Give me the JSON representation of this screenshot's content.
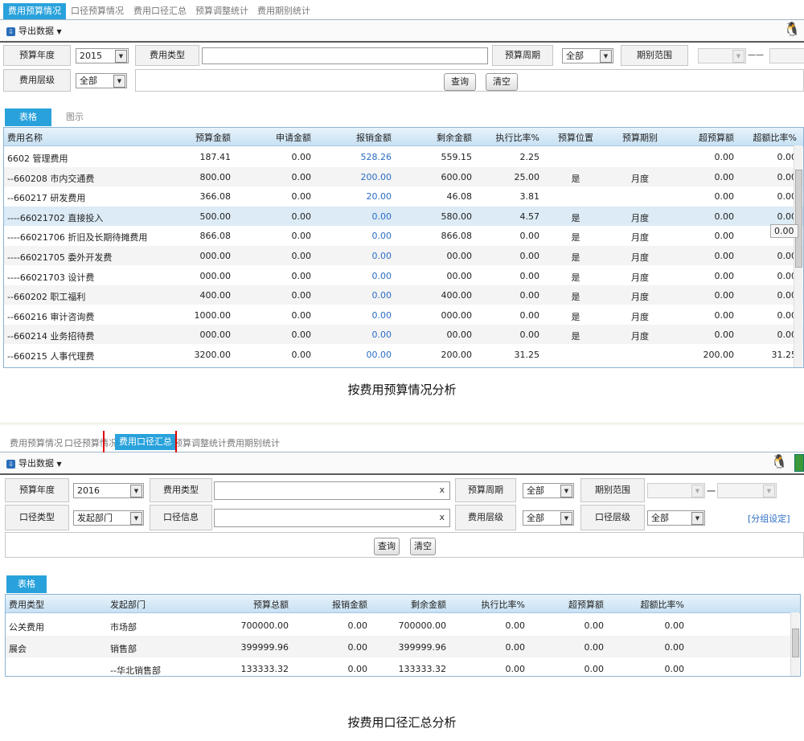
{
  "panel1": {
    "tabs": [
      "费用预算情况",
      "口径预算情况",
      "费用口径汇总",
      "预算调整统计",
      "费用期别统计"
    ],
    "export_label": "导出数据",
    "filters": {
      "year_label": "预算年度",
      "year_value": "2015",
      "type_label": "费用类型",
      "type_value": "",
      "period_label": "预算周期",
      "period_value": "全部",
      "range_label": "期别范围",
      "range_sep": "——",
      "level_label": "费用层级",
      "level_value": "全部"
    },
    "query_label": "查询",
    "clear_label": "清空",
    "grid_tabs": [
      "表格",
      "图示"
    ],
    "columns": [
      "费用名称",
      "预算金额",
      "申请金额",
      "报销金额",
      "剩余金额",
      "执行比率%",
      "预算位置",
      "预算期别",
      "超预算额",
      "超额比率%"
    ],
    "rows": [
      [
        "6602 管理费用",
        "187.41",
        "0.00",
        "528.26",
        "559.15",
        "2.25",
        "",
        "",
        "0.00",
        "0.00"
      ],
      [
        "--660208 市内交通费",
        "800.00",
        "0.00",
        "200.00",
        "600.00",
        "25.00",
        "是",
        "月度",
        "0.00",
        "0.00"
      ],
      [
        "--660217 研发费用",
        "366.08",
        "0.00",
        "20.00",
        "46.08",
        "3.81",
        "",
        "",
        "0.00",
        "0.00"
      ],
      [
        "----66021702 直接投入",
        "500.00",
        "0.00",
        "0.00",
        "580.00",
        "4.57",
        "是",
        "月度",
        "0.00",
        "0.00"
      ],
      [
        "----66021706 折旧及长期待摊费用",
        "866.08",
        "0.00",
        "0.00",
        "866.08",
        "0.00",
        "是",
        "月度",
        "0.00",
        ""
      ],
      [
        "----66021705 委外开发费",
        "000.00",
        "0.00",
        "0.00",
        "00.00",
        "0.00",
        "是",
        "月度",
        "0.00",
        "0.00"
      ],
      [
        "----66021703 设计费",
        "000.00",
        "0.00",
        "0.00",
        "00.00",
        "0.00",
        "是",
        "月度",
        "0.00",
        "0.00"
      ],
      [
        "--660202 职工福利",
        "400.00",
        "0.00",
        "0.00",
        "400.00",
        "0.00",
        "是",
        "月度",
        "0.00",
        "0.00"
      ],
      [
        "--660216 审计咨询费",
        "1000.00",
        "0.00",
        "0.00",
        "000.00",
        "0.00",
        "是",
        "月度",
        "0.00",
        "0.00"
      ],
      [
        "--660214 业务招待费",
        "000.00",
        "0.00",
        "0.00",
        "00.00",
        "0.00",
        "是",
        "月度",
        "0.00",
        "0.00"
      ],
      [
        "--660215 人事代理费",
        "3200.00",
        "0.00",
        "00.00",
        "200.00",
        "31.25",
        "",
        "",
        "200.00",
        "31.25"
      ]
    ],
    "tooltip": "0.00",
    "caption": "按费用预算情况分析"
  },
  "panel2": {
    "tabs": [
      "费用预算情况",
      "口径预算情况",
      "费用口径汇总",
      "预算调整统计",
      "费用期别统计"
    ],
    "export_label": "导出数据",
    "filters": {
      "year_label": "预算年度",
      "year_value": "2016",
      "type_label": "费用类型",
      "type_value": "",
      "clear_x": "x",
      "period_label": "预算周期",
      "period_value": "全部",
      "range_label": "期别范围",
      "range_sep": "一",
      "caliber_type_label": "口径类型",
      "caliber_type_value": "发起部门",
      "caliber_info_label": "口径信息",
      "caliber_info_value": "",
      "level_label": "费用层级",
      "level_value": "全部",
      "caliber_level_label": "口径层级",
      "caliber_level_value": "全部",
      "group_link": "[分组设定]"
    },
    "query_label": "查询",
    "clear_label": "清空",
    "grid_tabs": [
      "表格"
    ],
    "columns": [
      "费用类型",
      "发起部门",
      "预算总额",
      "报销金额",
      "剩余金额",
      "执行比率%",
      "超预算额",
      "超额比率%"
    ],
    "rows": [
      [
        "公关费用",
        "市场部",
        "700000.00",
        "0.00",
        "700000.00",
        "0.00",
        "0.00",
        "0.00"
      ],
      [
        "展会",
        "销售部",
        "399999.96",
        "0.00",
        "399999.96",
        "0.00",
        "0.00",
        "0.00"
      ],
      [
        "",
        "--华北销售部",
        "133333.32",
        "0.00",
        "133333.32",
        "0.00",
        "0.00",
        "0.00"
      ]
    ],
    "caption": "按费用口径汇总分析"
  }
}
